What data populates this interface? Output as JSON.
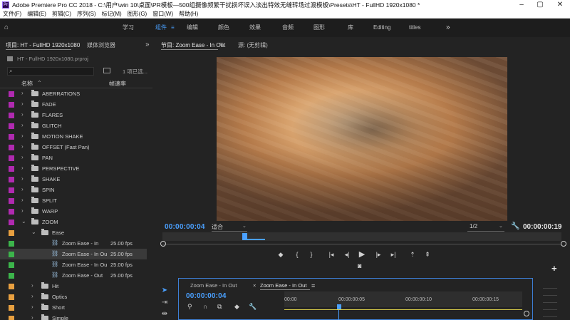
{
  "window": {
    "title": "Adobe Premiere Pro CC 2018 - C:\\用户\\win 10\\桌面\\PR模板—500组摄像频繁干扰损坏误入淡出特效无缝转场过渡模板\\Presets\\HT - FullHD 1920x1080 *",
    "app_icon": "Pr"
  },
  "menu": [
    "文件(F)",
    "编辑(E)",
    "剪辑(C)",
    "序列(S)",
    "标记(M)",
    "图形(G)",
    "窗口(W)",
    "帮助(H)"
  ],
  "workspace": {
    "items": [
      "学习",
      "组件",
      "编辑",
      "颜色",
      "效果",
      "音频",
      "图形",
      "库",
      "Editing",
      "titles"
    ],
    "active": "组件"
  },
  "project_panel": {
    "tabs": [
      "项目: HT - FullHD 1920x1080",
      "媒体浏览器"
    ],
    "file": "HT - FullHD 1920x1080.prproj",
    "selection_count": "1 项已选...",
    "columns": {
      "name": "名称",
      "fps": "帧速率"
    },
    "rows": [
      {
        "name": "ABERRATIONS",
        "color": "#b02ab0",
        "type": "bin",
        "indent": 0,
        "fps": ""
      },
      {
        "name": "FADE",
        "color": "#b02ab0",
        "type": "bin",
        "indent": 0,
        "fps": ""
      },
      {
        "name": "FLARES",
        "color": "#b02ab0",
        "type": "bin",
        "indent": 0,
        "fps": ""
      },
      {
        "name": "GLITCH",
        "color": "#b02ab0",
        "type": "bin",
        "indent": 0,
        "fps": ""
      },
      {
        "name": "MOTION SHAKE",
        "color": "#b02ab0",
        "type": "bin",
        "indent": 0,
        "fps": ""
      },
      {
        "name": "OFFSET (Fast Pan)",
        "color": "#b02ab0",
        "type": "bin",
        "indent": 0,
        "fps": ""
      },
      {
        "name": "PAN",
        "color": "#b02ab0",
        "type": "bin",
        "indent": 0,
        "fps": ""
      },
      {
        "name": "PERSPECTIVE",
        "color": "#b02ab0",
        "type": "bin",
        "indent": 0,
        "fps": ""
      },
      {
        "name": "SHAKE",
        "color": "#b02ab0",
        "type": "bin",
        "indent": 0,
        "fps": ""
      },
      {
        "name": "SPIN",
        "color": "#b02ab0",
        "type": "bin",
        "indent": 0,
        "fps": ""
      },
      {
        "name": "SPLIT",
        "color": "#b02ab0",
        "type": "bin",
        "indent": 0,
        "fps": ""
      },
      {
        "name": "WARP",
        "color": "#b02ab0",
        "type": "bin",
        "indent": 0,
        "fps": ""
      },
      {
        "name": "ZOOM",
        "color": "#b02ab0",
        "type": "bin-open",
        "indent": 0,
        "fps": ""
      },
      {
        "name": "Ease",
        "color": "#e8a040",
        "type": "bin-open",
        "indent": 1,
        "fps": ""
      },
      {
        "name": "Zoom Ease - In",
        "color": "#3cb44b",
        "type": "seq",
        "indent": 2,
        "fps": "25.00 fps"
      },
      {
        "name": "Zoom Ease - In Ou",
        "color": "#3cb44b",
        "type": "seq",
        "indent": 2,
        "fps": "25.00 fps",
        "selected": true
      },
      {
        "name": "Zoom Ease - In Ou",
        "color": "#3cb44b",
        "type": "seq",
        "indent": 2,
        "fps": "25.00 fps"
      },
      {
        "name": "Zoom Ease - Out",
        "color": "#3cb44b",
        "type": "seq",
        "indent": 2,
        "fps": "25.00 fps"
      },
      {
        "name": "Hit",
        "color": "#e8a040",
        "type": "bin",
        "indent": 1,
        "fps": ""
      },
      {
        "name": "Optics",
        "color": "#e8a040",
        "type": "bin",
        "indent": 1,
        "fps": ""
      },
      {
        "name": "Short",
        "color": "#e8a040",
        "type": "bin",
        "indent": 1,
        "fps": ""
      },
      {
        "name": "Simple",
        "color": "#e8a040",
        "type": "bin",
        "indent": 1,
        "fps": ""
      }
    ]
  },
  "program_monitor": {
    "tabs": [
      "节目: Zoom Ease - In  Out",
      "源: (无剪辑)"
    ],
    "current_tc": "00:00:00:04",
    "duration_tc": "00:00:00:19",
    "fit": "适合",
    "resolution": "1/2"
  },
  "timeline": {
    "tabs": [
      "Zoom Ease - In  Out",
      "Zoom Ease - In  Out"
    ],
    "current_tc": "00:00:00:04",
    "ruler": [
      "00:00",
      "00:00:00:05",
      "00:00:00:10",
      "00:00:00:15"
    ]
  },
  "colors": {
    "accent": "#4aa0ff",
    "purple_label": "#b02ab0",
    "orange_label": "#e8a040",
    "green_label": "#3cb44b"
  }
}
